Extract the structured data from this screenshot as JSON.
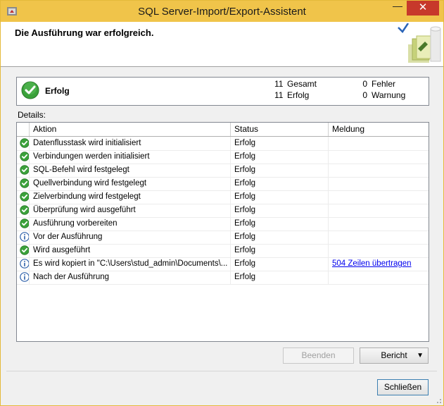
{
  "window": {
    "title": "SQL Server-Import/Export-Assistent",
    "close_glyph": "✕",
    "minimize_glyph": "—"
  },
  "header": {
    "title": "Die Ausführung war erfolgreich."
  },
  "summary": {
    "label": "Erfolg",
    "total_count": "11",
    "total_label": "Gesamt",
    "success_count": "11",
    "success_label": "Erfolg",
    "error_count": "0",
    "error_label": "Fehler",
    "warning_count": "0",
    "warning_label": "Warnung"
  },
  "details": {
    "label": "Details:",
    "columns": [
      "Aktion",
      "Status",
      "Meldung"
    ],
    "rows": [
      {
        "icon": "success-icon",
        "action": "Datenflusstask wird initialisiert",
        "status": "Erfolg",
        "message": ""
      },
      {
        "icon": "success-icon",
        "action": "Verbindungen werden initialisiert",
        "status": "Erfolg",
        "message": ""
      },
      {
        "icon": "success-icon",
        "action": "SQL-Befehl wird festgelegt",
        "status": "Erfolg",
        "message": ""
      },
      {
        "icon": "success-icon",
        "action": "Quellverbindung wird festgelegt",
        "status": "Erfolg",
        "message": ""
      },
      {
        "icon": "success-icon",
        "action": "Zielverbindung wird festgelegt",
        "status": "Erfolg",
        "message": ""
      },
      {
        "icon": "success-icon",
        "action": "Überprüfung wird ausgeführt",
        "status": "Erfolg",
        "message": ""
      },
      {
        "icon": "success-icon",
        "action": "Ausführung vorbereiten",
        "status": "Erfolg",
        "message": ""
      },
      {
        "icon": "info-icon",
        "action": "Vor der Ausführung",
        "status": "Erfolg",
        "message": ""
      },
      {
        "icon": "success-icon",
        "action": "Wird ausgeführt",
        "status": "Erfolg",
        "message": ""
      },
      {
        "icon": "info-icon",
        "action": "Es wird kopiert in \"C:\\Users\\stud_admin\\Documents\\...",
        "status": "Erfolg",
        "message": "504 Zeilen übertragen"
      },
      {
        "icon": "info-icon",
        "action": "Nach der Ausführung",
        "status": "Erfolg",
        "message": ""
      }
    ]
  },
  "buttons": {
    "stop": "Beenden",
    "report": "Bericht",
    "report_arrow": "▼",
    "close": "Schließen"
  },
  "colors": {
    "titlebar": "#f0c44a",
    "close": "#c7392b",
    "success": "#3aa13a",
    "info": "#2b5ea8",
    "link": "#0000ee"
  }
}
